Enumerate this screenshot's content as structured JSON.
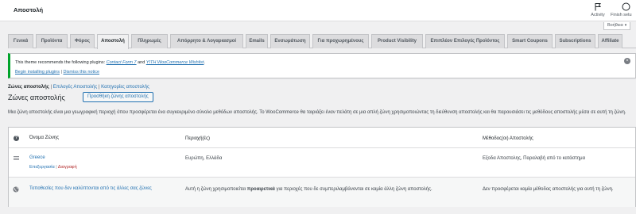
{
  "header": {
    "title": "Αποστολή",
    "activity_label": "Activity",
    "finish_label": "Finish setu"
  },
  "help": {
    "label": "Βοήθεια"
  },
  "tabs": [
    {
      "label": "Γενικά",
      "active": false
    },
    {
      "label": "Προϊόντα",
      "active": false
    },
    {
      "label": "Φόρος",
      "active": false
    },
    {
      "label": "Αποστολή",
      "active": true
    },
    {
      "label": "Πληρωμές",
      "active": false
    },
    {
      "label": "Απόρρητο & Λογαριασμοί",
      "active": false
    },
    {
      "label": "Emails",
      "active": false
    },
    {
      "label": "Ενσωμάτωση",
      "active": false
    },
    {
      "label": "Για προχωρημένους",
      "active": false
    },
    {
      "label": "Product Visibility",
      "active": false
    },
    {
      "label": "Επιπλέον Επιλογές Προϊόντος",
      "active": false
    },
    {
      "label": "Smart Coupons",
      "active": false
    },
    {
      "label": "Subscriptions",
      "active": false
    },
    {
      "label": "Affiliate",
      "active": false
    }
  ],
  "notice": {
    "text_before": "This theme recommends the following plugins: ",
    "plugin1": "Contact Form 7",
    "and": " and ",
    "plugin2": "YITH WooCommerce Wishlist",
    "text_after": ".",
    "begin_link": "Begin installing plugins",
    "separator": " | ",
    "dismiss_link": "Dismiss this notice"
  },
  "subsub": {
    "current": "Ζώνες αποστολής",
    "sep": " | ",
    "options": "Επιλογές Αποστολής",
    "classes": "Κατηγορίες αποστολής"
  },
  "zones": {
    "title": "Ζώνες αποστολής",
    "add_button": "Προσθήκη ζώνης αποστολής",
    "description": "Μια ζώνη αποστολής είναι μια γεωγραφική περιοχή όπου προσφέρεται ένα συγκεκριμένο σύνολο μεθόδων αποστολής. Το WooCommerce θα ταιριάξει έναν πελάτη σε μια απλή ζώνη χρησιμοποιώντας τη διεύθυνση αποστολής και θα παρουσιάσει τις μεθόδους αποστολής μέσα σε αυτή τη ζώνη.",
    "columns": {
      "name": "Όνομα Ζώνης",
      "region": "Περιοχή(ές)",
      "method": "Μέθοδος(οι) Αποστολής"
    },
    "rows": [
      {
        "name": "Greece",
        "edit": "Επεξεργασία",
        "sep": " | ",
        "delete": "Διαγραφή",
        "region": "Ευρώπη, Ελλάδα",
        "method": "Εξοδα Αποστολης, Παραλαβή από το κατάστημα"
      }
    ],
    "rest": {
      "name": "Τοποθεσίες που δεν καλύπτονται από τις άλλες σας ζώνες",
      "region_before": "Αυτή η ζώνη χρησιμοποιείται ",
      "region_bold": "προαιρετικά",
      "region_after": " για περιοχές που δε συμπεριλαμβάνονται σε καμία άλλη ζώνη αποστολής.",
      "method": "Δεν προσφέρεται καμία μέθοδος αποστολής για αυτή τη ζώνη."
    }
  },
  "colors": {
    "accent": "#2271b1",
    "notice_border": "#00a32a",
    "delete": "#b32d2e"
  }
}
